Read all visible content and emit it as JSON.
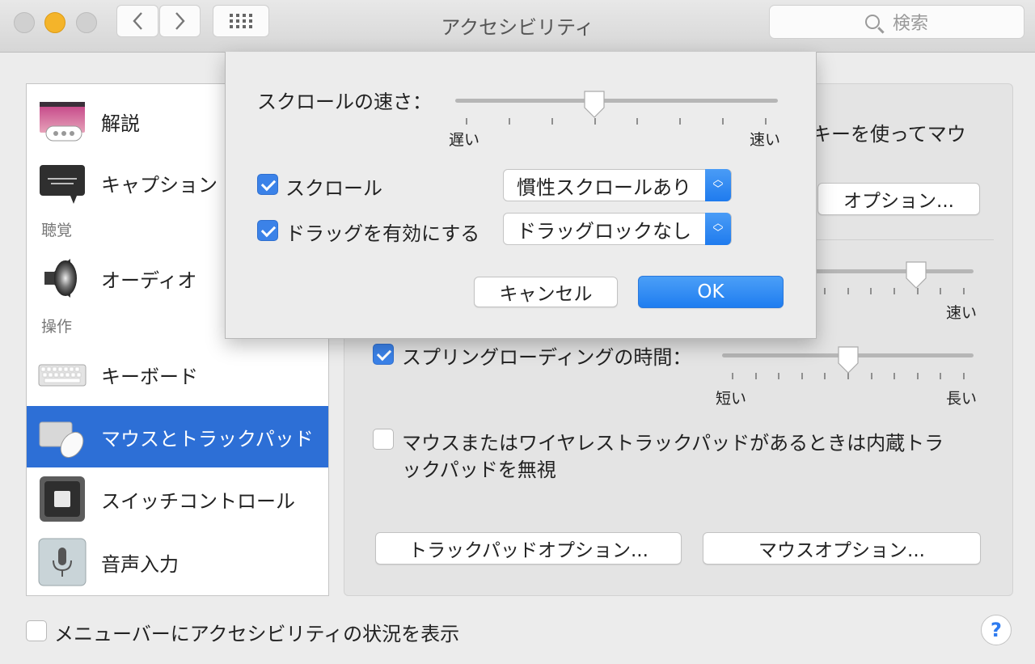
{
  "window": {
    "title": "アクセシビリティ",
    "search_placeholder": "検索"
  },
  "toolbar": {
    "back": "‹",
    "forward": "›"
  },
  "sidebar": {
    "items": [
      {
        "label": "解説",
        "icon": "descriptions-icon"
      },
      {
        "label": "キャプション",
        "icon": "captions-icon"
      },
      {
        "label": "オーディオ",
        "icon": "speaker-icon"
      },
      {
        "label": "キーボード",
        "icon": "keyboard-icon"
      },
      {
        "label": "マウスとトラックパッド",
        "icon": "mouse-trackpad-icon",
        "selected": true
      },
      {
        "label": "スイッチコントロール",
        "icon": "switch-control-icon"
      },
      {
        "label": "音声入力",
        "icon": "microphone-icon"
      }
    ],
    "sections": {
      "hearing": "聴覚",
      "interaction": "操作"
    }
  },
  "main": {
    "partial_text": "キーを使ってマウ",
    "options_button": "オプション...",
    "top_slider": {
      "max_label": "速い",
      "value": 0.64
    },
    "spring_loading": {
      "label": "スプリングローディングの時間：",
      "checked": true,
      "min_label": "短い",
      "max_label": "長い",
      "value": 0.5
    },
    "ignore_trackpad": {
      "line1": "マウスまたはワイヤレストラックパッドがあるときは内蔵トラ",
      "line2": "ックパッドを無視",
      "checked": false
    },
    "trackpad_options_button": "トラックパッドオプション...",
    "mouse_options_button": "マウスオプション..."
  },
  "dialog": {
    "scroll_speed_label": "スクロールの速さ：",
    "slider_min_label": "遅い",
    "slider_max_label": "速い",
    "scroll_speed_value": 0.43,
    "scroll": {
      "label": "スクロール",
      "checked": true,
      "popup_value": "慣性スクロールあり"
    },
    "drag": {
      "label": "ドラッグを有効にする",
      "checked": true,
      "popup_value": "ドラッグロックなし"
    },
    "cancel_button": "キャンセル",
    "ok_button": "OK"
  },
  "footer": {
    "show_status_label": "メニューバーにアクセシビリティの状況を表示",
    "checked": false,
    "help": "?"
  },
  "colors": {
    "accent": "#2d6fd6",
    "checkbox": "#3b82e8",
    "traffic_yellow": "#f4b42a"
  }
}
